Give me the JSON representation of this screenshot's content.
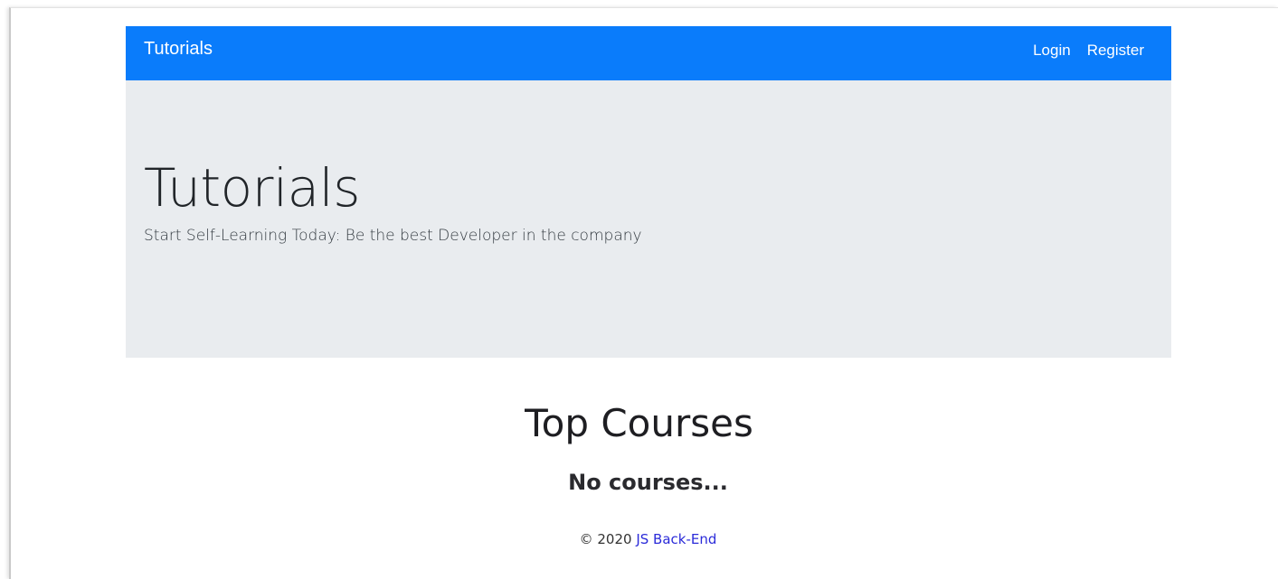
{
  "navbar": {
    "brand": "Tutorials",
    "links": [
      "Login",
      "Register"
    ],
    "background": "#0a7cfb"
  },
  "jumbotron": {
    "title": "Tutorials",
    "lead": "Start Self-Learning Today: Be the best Developer in the company",
    "background": "#e9ecef"
  },
  "main": {
    "section_title": "Top Courses",
    "empty_message": "No courses..."
  },
  "footer": {
    "copyright": "© 2020",
    "link_text": "JS Back-End",
    "link_color": "#2b2bd9"
  }
}
